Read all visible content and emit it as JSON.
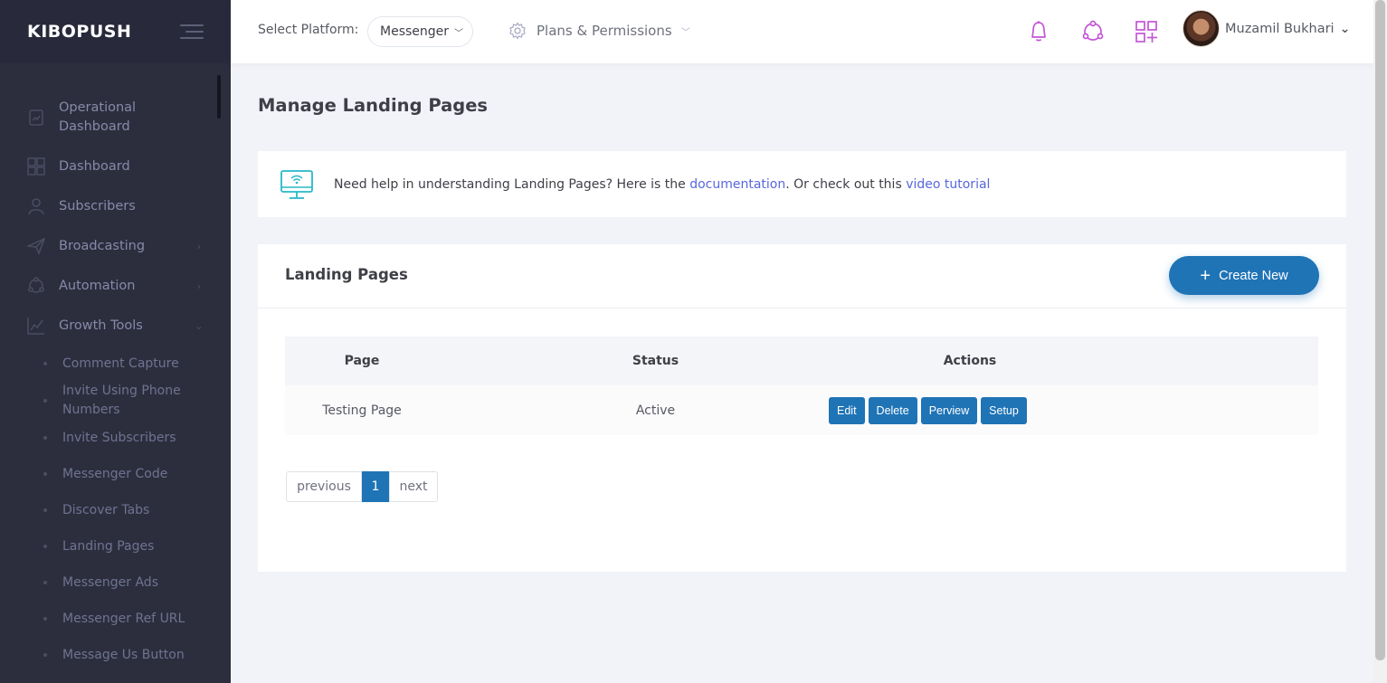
{
  "brand": {
    "name": "KIBOPUSH"
  },
  "sidebar": {
    "items": [
      {
        "label": "Operational Dashboard",
        "icon": "chart-file-icon",
        "arrow": ""
      },
      {
        "label": "Dashboard",
        "icon": "grid-icon",
        "arrow": ""
      },
      {
        "label": "Subscribers",
        "icon": "user-icon",
        "arrow": ""
      },
      {
        "label": "Broadcasting",
        "icon": "paper-plane-icon",
        "arrow": "›"
      },
      {
        "label": "Automation",
        "icon": "network-icon",
        "arrow": "›"
      },
      {
        "label": "Growth Tools",
        "icon": "line-chart-icon",
        "arrow": "⌄"
      }
    ],
    "sub_items": [
      "Comment Capture",
      "Invite Using Phone Numbers",
      "Invite Subscribers",
      "Messenger Code",
      "Discover Tabs",
      "Landing Pages",
      "Messenger Ads",
      "Messenger Ref URL",
      "Message Us Button"
    ]
  },
  "header": {
    "platform_label": "Select Platform:",
    "platform_value": "Messenger",
    "plans_label": "Plans & Permissions",
    "icons": [
      "bell-icon",
      "network-icon",
      "apps-add-icon"
    ],
    "user_name": "Muzamil Bukhari"
  },
  "page": {
    "title": "Manage Landing Pages"
  },
  "help": {
    "text_before": "Need help in understanding Landing Pages? Here is the ",
    "doc_link": "documentation",
    "text_middle": ". Or check out this ",
    "video_link": "video tutorial"
  },
  "portlet": {
    "title": "Landing Pages",
    "create_label": "Create New"
  },
  "table": {
    "headers": {
      "page": "Page",
      "status": "Status",
      "actions": "Actions"
    },
    "rows": [
      {
        "page": "Testing Page",
        "status": "Active",
        "actions": [
          "Edit",
          "Delete",
          "Perview",
          "Setup"
        ]
      }
    ]
  },
  "pagination": {
    "previous": "previous",
    "current": "1",
    "next": "next"
  },
  "colors": {
    "accent": "#1f74b6",
    "sidebar_bg": "#2c2e3e",
    "link": "#5867dd",
    "icon_pink": "#c456d6"
  }
}
